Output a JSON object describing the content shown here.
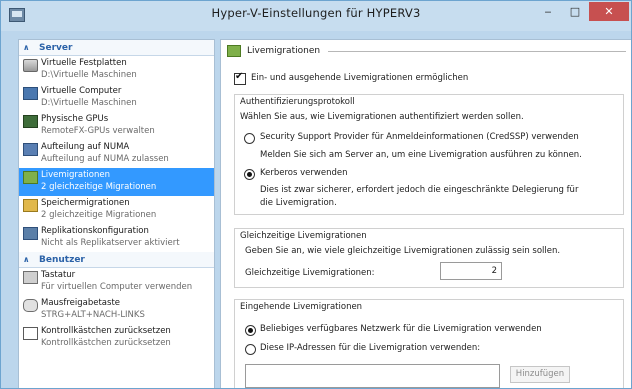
{
  "window": {
    "title": "Hyper-V-Einstellungen für HYPERV3"
  },
  "nav": {
    "server_header": "Server",
    "server_items": [
      {
        "label": "Virtuelle Festplatten",
        "sub": "D:\\Virtuelle Maschinen",
        "icon": "disk-icon"
      },
      {
        "label": "Virtuelle Computer",
        "sub": "D:\\Virtuelle Maschinen",
        "icon": "vm-icon"
      },
      {
        "label": "Physische GPUs",
        "sub": "RemoteFX-GPUs verwalten",
        "icon": "gpu-icon"
      },
      {
        "label": "Aufteilung auf NUMA",
        "sub": "Aufteilung auf NUMA zulassen",
        "icon": "numa-icon"
      },
      {
        "label": "Livemigrationen",
        "sub": "2 gleichzeitige Migrationen",
        "icon": "migration-icon"
      },
      {
        "label": "Speichermigrationen",
        "sub": "2 gleichzeitige Migrationen",
        "icon": "storage-icon"
      },
      {
        "label": "Replikationskonfiguration",
        "sub": "Nicht als Replikatserver aktiviert",
        "icon": "replication-icon"
      }
    ],
    "user_header": "Benutzer",
    "user_items": [
      {
        "label": "Tastatur",
        "sub": "Für virtuellen Computer verwenden",
        "icon": "keyboard-icon"
      },
      {
        "label": "Mausfreigabetaste",
        "sub": "STRG+ALT+NACH-LINKS",
        "icon": "mouse-icon"
      },
      {
        "label": "Kontrollkästchen zurücksetzen",
        "sub": "Kontrollkästchen zurücksetzen",
        "icon": "checkbox-reset-icon"
      }
    ]
  },
  "content": {
    "section_title": "Livemigrationen",
    "enable_checkbox": "Ein- und ausgehende Livemigrationen ermöglichen",
    "auth": {
      "title": "Authentifizierungsprotokoll",
      "desc": "Wählen Sie aus, wie Livemigrationen authentifiziert werden sollen.",
      "credssp_label": "Security Support Provider für Anmeldeinformationen (CredSSP) verwenden",
      "credssp_desc": "Melden Sie sich am Server an, um eine Livemigration ausführen zu können.",
      "kerberos_label": "Kerberos verwenden",
      "kerberos_desc1": "Dies ist zwar sicherer, erfordert jedoch die eingeschränkte Delegierung für",
      "kerberos_desc2": "die Livemigration."
    },
    "concurrent": {
      "title": "Gleichzeitige Livemigrationen",
      "desc": "Geben Sie an, wie viele gleichzeitige Livemigrationen zulässig sein sollen.",
      "field_label": "Gleichzeitige Livemigrationen:",
      "value": "2"
    },
    "incoming": {
      "title": "Eingehende Livemigrationen",
      "any_network": "Beliebiges verfügbares Netzwerk für die Livemigration verwenden",
      "these_ips": "Diese IP-Adressen für die Livemigration verwenden:",
      "add_button": "Hinzufügen"
    }
  }
}
